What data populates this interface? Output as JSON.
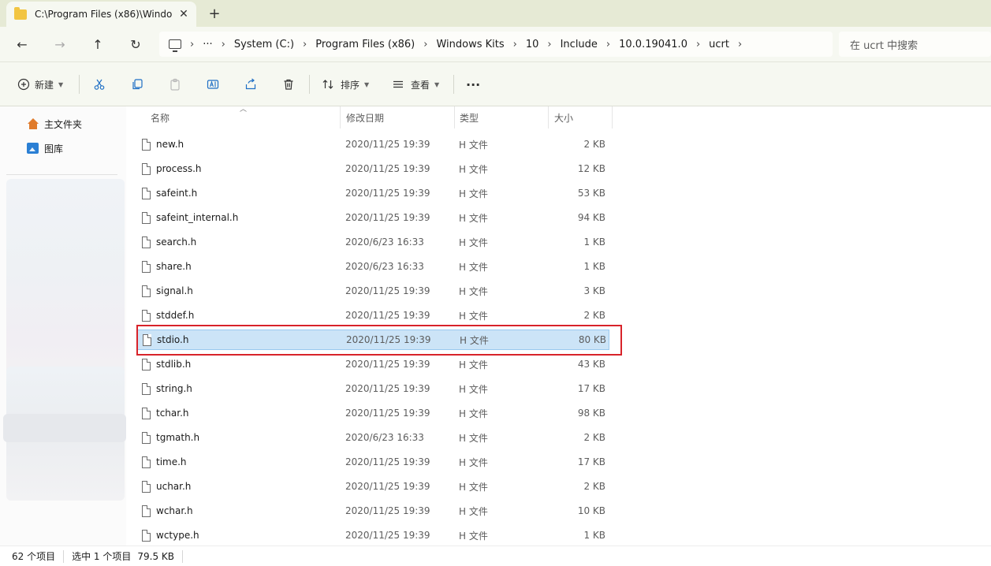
{
  "tab": {
    "title": "C:\\Program Files (x86)\\Windo",
    "close": "✕",
    "new": "+"
  },
  "nav": {
    "back": "←",
    "forward": "→",
    "up": "↑",
    "refresh": "↻"
  },
  "breadcrumb": {
    "more": "···",
    "sep": "›",
    "items": [
      "System (C:)",
      "Program Files (x86)",
      "Windows Kits",
      "10",
      "Include",
      "10.0.19041.0",
      "ucrt"
    ]
  },
  "search": {
    "placeholder": "在 ucrt 中搜索"
  },
  "toolbar": {
    "new_label": "新建",
    "sort_label": "排序",
    "view_label": "查看",
    "more": "···"
  },
  "sidebar": {
    "home": "主文件夹",
    "gallery": "图库"
  },
  "columns": {
    "name": "名称",
    "date": "修改日期",
    "type": "类型",
    "size": "大小"
  },
  "files": [
    {
      "name": "new.h",
      "date": "2020/11/25 19:39",
      "type": "H 文件",
      "size": "2 KB"
    },
    {
      "name": "process.h",
      "date": "2020/11/25 19:39",
      "type": "H 文件",
      "size": "12 KB"
    },
    {
      "name": "safeint.h",
      "date": "2020/11/25 19:39",
      "type": "H 文件",
      "size": "53 KB"
    },
    {
      "name": "safeint_internal.h",
      "date": "2020/11/25 19:39",
      "type": "H 文件",
      "size": "94 KB"
    },
    {
      "name": "search.h",
      "date": "2020/6/23 16:33",
      "type": "H 文件",
      "size": "1 KB"
    },
    {
      "name": "share.h",
      "date": "2020/6/23 16:33",
      "type": "H 文件",
      "size": "1 KB"
    },
    {
      "name": "signal.h",
      "date": "2020/11/25 19:39",
      "type": "H 文件",
      "size": "3 KB"
    },
    {
      "name": "stddef.h",
      "date": "2020/11/25 19:39",
      "type": "H 文件",
      "size": "2 KB"
    },
    {
      "name": "stdio.h",
      "date": "2020/11/25 19:39",
      "type": "H 文件",
      "size": "80 KB",
      "selected": true
    },
    {
      "name": "stdlib.h",
      "date": "2020/11/25 19:39",
      "type": "H 文件",
      "size": "43 KB"
    },
    {
      "name": "string.h",
      "date": "2020/11/25 19:39",
      "type": "H 文件",
      "size": "17 KB"
    },
    {
      "name": "tchar.h",
      "date": "2020/11/25 19:39",
      "type": "H 文件",
      "size": "98 KB"
    },
    {
      "name": "tgmath.h",
      "date": "2020/6/23 16:33",
      "type": "H 文件",
      "size": "2 KB"
    },
    {
      "name": "time.h",
      "date": "2020/11/25 19:39",
      "type": "H 文件",
      "size": "17 KB"
    },
    {
      "name": "uchar.h",
      "date": "2020/11/25 19:39",
      "type": "H 文件",
      "size": "2 KB"
    },
    {
      "name": "wchar.h",
      "date": "2020/11/25 19:39",
      "type": "H 文件",
      "size": "10 KB"
    },
    {
      "name": "wctype.h",
      "date": "2020/11/25 19:39",
      "type": "H 文件",
      "size": "1 KB"
    }
  ],
  "status": {
    "count": "62 个项目",
    "selected": "选中 1 个项目",
    "selected_size": "79.5 KB"
  },
  "colors": {
    "selection": "#cce4f7",
    "highlight_border": "#d8232a",
    "accent": "#2a7fd4"
  }
}
